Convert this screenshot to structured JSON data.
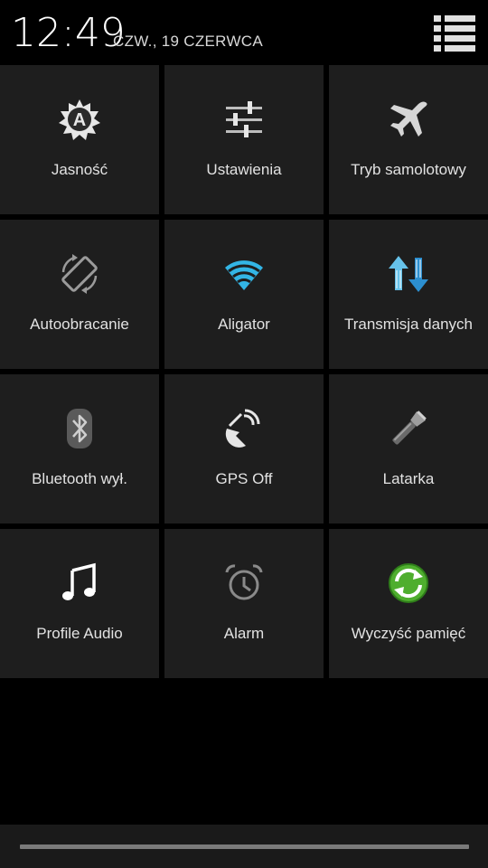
{
  "header": {
    "time": "12:49",
    "date": "CZW., 19 CZERWCA",
    "settings_icon": "settings-list-icon"
  },
  "tiles": [
    {
      "label": "Jasność",
      "icon": "brightness-auto-icon"
    },
    {
      "label": "Ustawienia",
      "icon": "sliders-icon"
    },
    {
      "label": "Tryb samolotowy",
      "icon": "airplane-icon"
    },
    {
      "label": "Autoobracanie",
      "icon": "auto-rotate-icon"
    },
    {
      "label": "Aligator",
      "icon": "wifi-icon"
    },
    {
      "label": "Transmisja danych",
      "icon": "data-transfer-icon"
    },
    {
      "label": "Bluetooth wył.",
      "icon": "bluetooth-icon"
    },
    {
      "label": "GPS Off",
      "icon": "gps-icon"
    },
    {
      "label": "Latarka",
      "icon": "flashlight-icon"
    },
    {
      "label": "Profile Audio",
      "icon": "music-note-icon"
    },
    {
      "label": "Alarm",
      "icon": "alarm-clock-icon"
    },
    {
      "label": "Wyczyść pamięć",
      "icon": "clear-memory-icon"
    }
  ],
  "colors": {
    "background": "#000000",
    "tile": "#1e1e1e",
    "accent_blue": "#33b5e5",
    "accent_green": "#5cc23b",
    "icon_white": "#e0e0e0",
    "icon_dim": "#8a8a8a"
  }
}
